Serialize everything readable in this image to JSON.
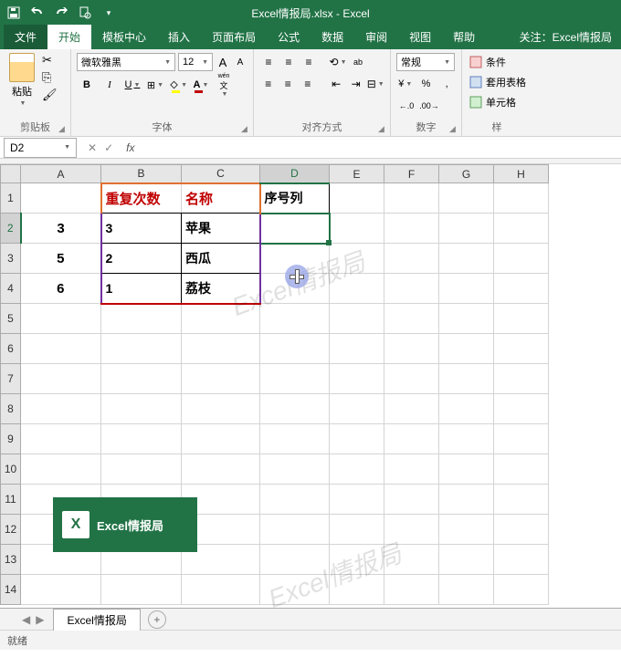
{
  "app": {
    "title": "Excel情报局.xlsx - Excel"
  },
  "menu": {
    "file": "文件",
    "tabs": [
      "开始",
      "模板中心",
      "插入",
      "页面布局",
      "公式",
      "数据",
      "审阅",
      "视图",
      "帮助"
    ],
    "active": "开始",
    "follow": "关注：Excel情报局"
  },
  "ribbon": {
    "clipboard": {
      "paste": "粘贴",
      "label": "剪贴板"
    },
    "font": {
      "name": "微软雅黑",
      "size": "12",
      "label": "字体",
      "bold": "B",
      "italic": "I",
      "underline": "U",
      "size_up": "A",
      "size_down": "A",
      "phonetic": "wén",
      "phonetic_a": "A"
    },
    "align": {
      "label": "对齐方式",
      "wrap": "ab"
    },
    "number": {
      "format": "常规",
      "label": "数字",
      "pct": "%",
      "comma": ",",
      "dec_inc": ".0",
      "dec_dec": ".00"
    },
    "styles": {
      "cond": "条件",
      "table": "套用表格",
      "cell": "单元格",
      "label": "样"
    }
  },
  "formula_bar": {
    "name_box": "D2",
    "fx": "fx",
    "value": ""
  },
  "grid": {
    "cols": [
      "A",
      "B",
      "C",
      "D",
      "E",
      "F",
      "G",
      "H"
    ],
    "row_count": 14,
    "active_col": "D",
    "active_row": 2,
    "headers": {
      "b1": "重复次数",
      "c1": "名称",
      "d1": "序号列"
    },
    "a_col": {
      "2": "3",
      "3": "5",
      "4": "6"
    },
    "data": [
      {
        "count": "3",
        "name": "苹果"
      },
      {
        "count": "2",
        "name": "西瓜"
      },
      {
        "count": "1",
        "name": "荔枝"
      }
    ]
  },
  "watermark": "Excel情报局",
  "logo": {
    "x": "X",
    "text": "Excel情报局"
  },
  "sheet": {
    "name": "Excel情报局"
  },
  "status": {
    "ready": "就绪"
  }
}
